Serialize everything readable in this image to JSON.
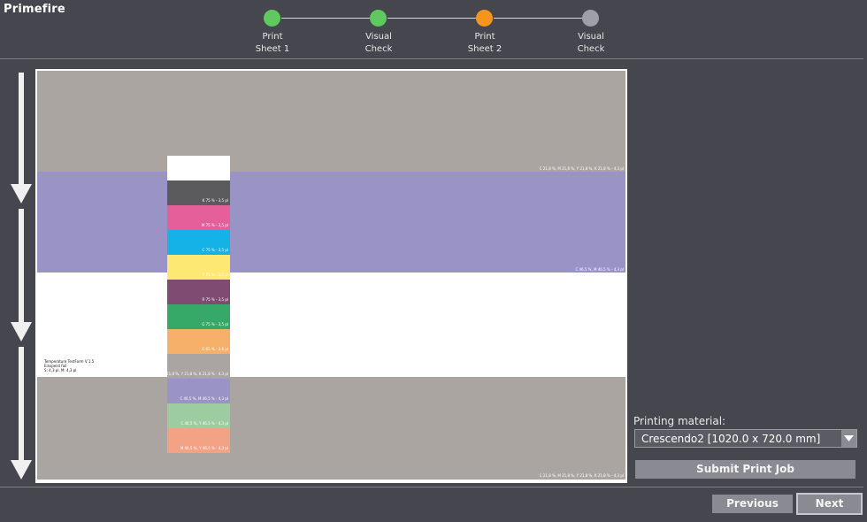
{
  "app": {
    "title": "Primefire"
  },
  "stepper": {
    "steps": [
      {
        "line1": "Print",
        "line2": "Sheet 1",
        "color": "#5fc95f"
      },
      {
        "line1": "Visual",
        "line2": "Check",
        "color": "#5fc95f"
      },
      {
        "line1": "Print",
        "line2": "Sheet 2",
        "color": "#f7941d"
      },
      {
        "line1": "Visual",
        "line2": "Check",
        "color": "#9ea0a8"
      }
    ]
  },
  "preview": {
    "bands": [
      {
        "color": "#aba5a2",
        "label": "C 21,8 %, M 21,8 %, Y 21,8 %, K 21,8 % - 4,3 pl"
      },
      {
        "color": "#9a93c5",
        "label": "C 46,5 %, M 46,5 % - 4,3 pl"
      },
      {
        "color": "#ffffff",
        "label": ""
      },
      {
        "color": "#aba5a2",
        "label": "C 21,8 %, M 21,8 %, Y 21,8 %, K 21,8 % - 4,3 pl"
      }
    ],
    "test_info": {
      "line1": "Temperature TestForm V 1.5",
      "line2": "Einspeist fail",
      "line3": "S: 4,3 pl, M: 4,3 pl"
    },
    "swatches": [
      {
        "color": "#ffffff",
        "label": ""
      },
      {
        "color": "#5b5b5d",
        "label": "K 75 % - 3,5 pl"
      },
      {
        "color": "#e5609a",
        "label": "M 75 % - 3,5 pl"
      },
      {
        "color": "#14b2e6",
        "label": "C 75 % - 3,5 pl"
      },
      {
        "color": "#fde874",
        "label": "Y 75 % - 3,5 pl"
      },
      {
        "color": "#7f4b72",
        "label": "R 75 % - 3,5 pl"
      },
      {
        "color": "#36a868",
        "label": "G 75 % - 3,5 pl"
      },
      {
        "color": "#f6b06a",
        "label": "O 65 % - 3,6 pl"
      },
      {
        "color": "#aaa4a2",
        "label": "C 21,8 %, M 21,8 %, Y 21,8 %, K 21,8 % - 4,3 pl"
      },
      {
        "color": "#9a93c5",
        "label": "C 46,5 %, M 46,5 % - 4,3 pl"
      },
      {
        "color": "#9dcca0",
        "label": "C 46,5 %, Y 46,5 % - 4,3 pl"
      },
      {
        "color": "#f4a285",
        "label": "M 46,5 %, Y 46,5 % - 4,3 pl"
      }
    ]
  },
  "printing_material": {
    "label": "Printing material:",
    "value": "Crescendo2 [1020.0 x 720.0 mm]"
  },
  "buttons": {
    "submit": "Submit Print Job",
    "previous": "Previous",
    "next": "Next"
  }
}
